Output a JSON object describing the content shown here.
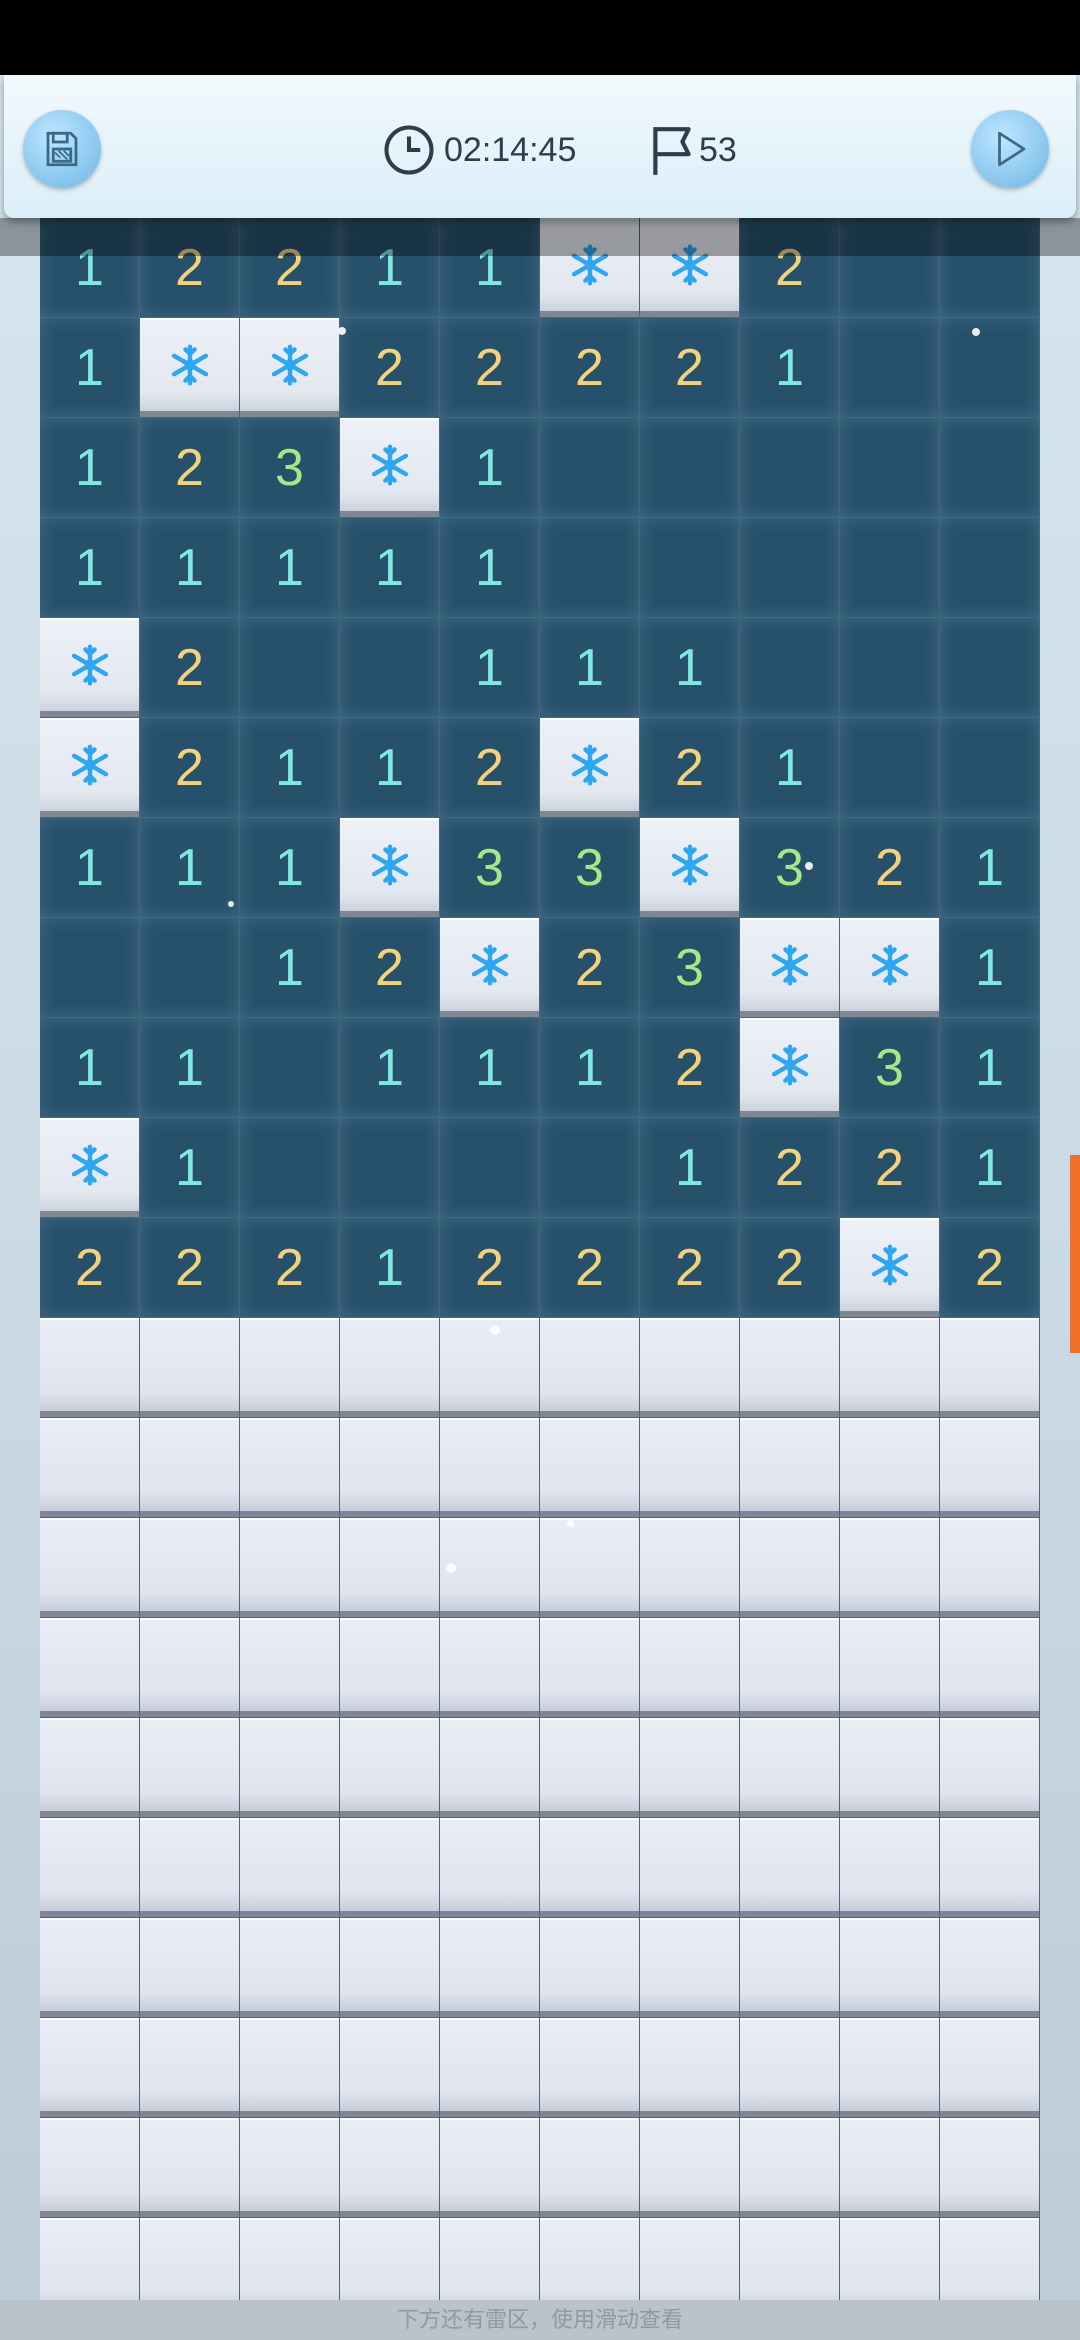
{
  "header": {
    "timer": "02:14:45",
    "flag_count": "53",
    "save_icon": "save-icon",
    "clock_icon": "clock-icon",
    "flag_icon": "flag-icon",
    "play_icon": "play-icon"
  },
  "board": {
    "columns": 10,
    "rows": [
      [
        "1",
        "2",
        "2",
        "1",
        "1",
        "F",
        "F",
        "2",
        "",
        ""
      ],
      [
        "1",
        "F",
        "F",
        "2",
        "2",
        "2",
        "2",
        "1",
        "",
        ""
      ],
      [
        "1",
        "2",
        "3",
        "F",
        "1",
        "",
        "",
        "",
        "",
        ""
      ],
      [
        "1",
        "1",
        "1",
        "1",
        "1",
        "",
        "",
        "",
        "",
        ""
      ],
      [
        "F",
        "2",
        "",
        "",
        "1",
        "1",
        "1",
        "",
        "",
        ""
      ],
      [
        "F",
        "2",
        "1",
        "1",
        "2",
        "F",
        "2",
        "1",
        "",
        ""
      ],
      [
        "1",
        "1",
        "1",
        "F",
        "3",
        "3",
        "F",
        "3",
        "2",
        "1"
      ],
      [
        "",
        "",
        "1",
        "2",
        "F",
        "2",
        "3",
        "F",
        "F",
        "1"
      ],
      [
        "1",
        "1",
        "",
        "1",
        "1",
        "1",
        "2",
        "F",
        "3",
        "1"
      ],
      [
        "F",
        "1",
        "",
        "",
        "",
        "",
        "1",
        "2",
        "2",
        "1"
      ],
      [
        "2",
        "2",
        "2",
        "1",
        "2",
        "2",
        "2",
        "2",
        "F",
        "2"
      ],
      [
        "H",
        "H",
        "H",
        "H",
        "H",
        "H",
        "H",
        "H",
        "H",
        "H"
      ],
      [
        "H",
        "H",
        "H",
        "H",
        "H",
        "H",
        "H",
        "H",
        "H",
        "H"
      ],
      [
        "H",
        "H",
        "H",
        "H",
        "H",
        "H",
        "H",
        "H",
        "H",
        "H"
      ],
      [
        "H",
        "H",
        "H",
        "H",
        "H",
        "H",
        "H",
        "H",
        "H",
        "H"
      ],
      [
        "H",
        "H",
        "H",
        "H",
        "H",
        "H",
        "H",
        "H",
        "H",
        "H"
      ],
      [
        "H",
        "H",
        "H",
        "H",
        "H",
        "H",
        "H",
        "H",
        "H",
        "H"
      ],
      [
        "H",
        "H",
        "H",
        "H",
        "H",
        "H",
        "H",
        "H",
        "H",
        "H"
      ],
      [
        "H",
        "H",
        "H",
        "H",
        "H",
        "H",
        "H",
        "H",
        "H",
        "H"
      ],
      [
        "H",
        "H",
        "H",
        "H",
        "H",
        "H",
        "H",
        "H",
        "H",
        "H"
      ],
      [
        "H",
        "H",
        "H",
        "H",
        "H",
        "H",
        "H",
        "H",
        "H",
        "H"
      ]
    ],
    "legend": {
      "F": "flag (snowflake)",
      "H": "hidden"
    }
  },
  "colors": {
    "number_1": "#7fe8e0",
    "number_2": "#f2d27a",
    "number_3": "#a6e885",
    "flag": "#2ea7f0",
    "scroll_accent": "#f0702a"
  },
  "footer": {
    "hint": "下方还有雷区，使用滑动查看"
  }
}
